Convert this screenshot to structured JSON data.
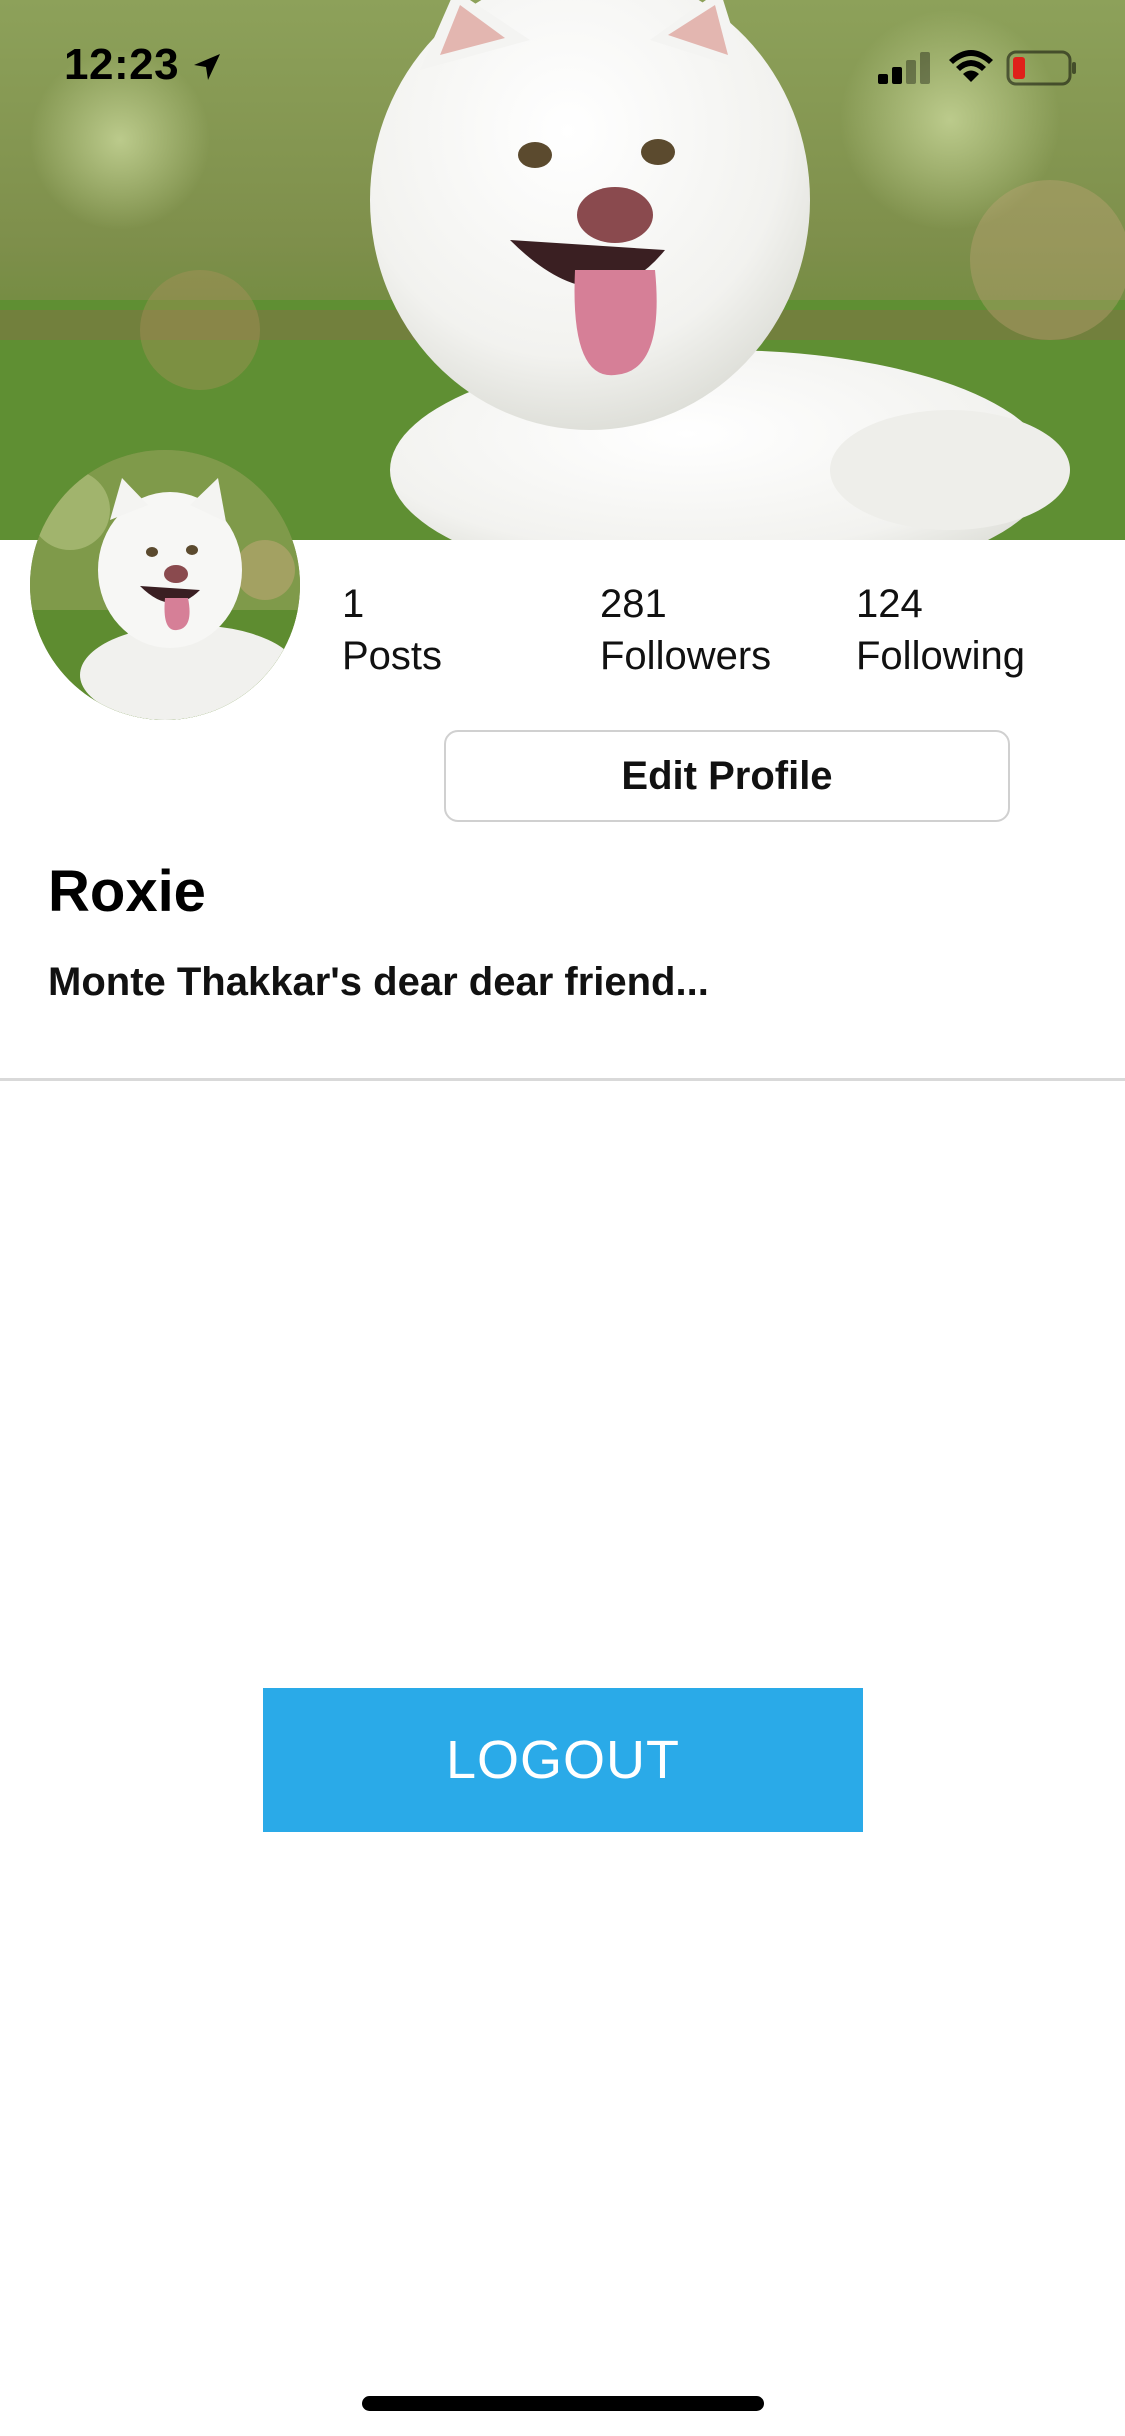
{
  "status_bar": {
    "time": "12:23",
    "location_icon": "location-arrow-icon",
    "signal_icon": "cellular-signal-icon",
    "wifi_icon": "wifi-icon",
    "battery_icon": "battery-low-icon"
  },
  "profile": {
    "cover_image": "white-dog-photo",
    "avatar_image": "white-dog-avatar",
    "stats": {
      "posts": {
        "value": "1",
        "label": "Posts"
      },
      "followers": {
        "value": "281",
        "label": "Followers"
      },
      "following": {
        "value": "124",
        "label": "Following"
      }
    },
    "edit_button_label": "Edit Profile",
    "name": "Roxie",
    "bio": "Monte Thakkar's dear dear friend..."
  },
  "actions": {
    "logout_label": "LOGOUT"
  },
  "colors": {
    "logout_bg": "#2aaae8",
    "battery_low": "#e0201a",
    "divider": "#d9d9d9"
  }
}
